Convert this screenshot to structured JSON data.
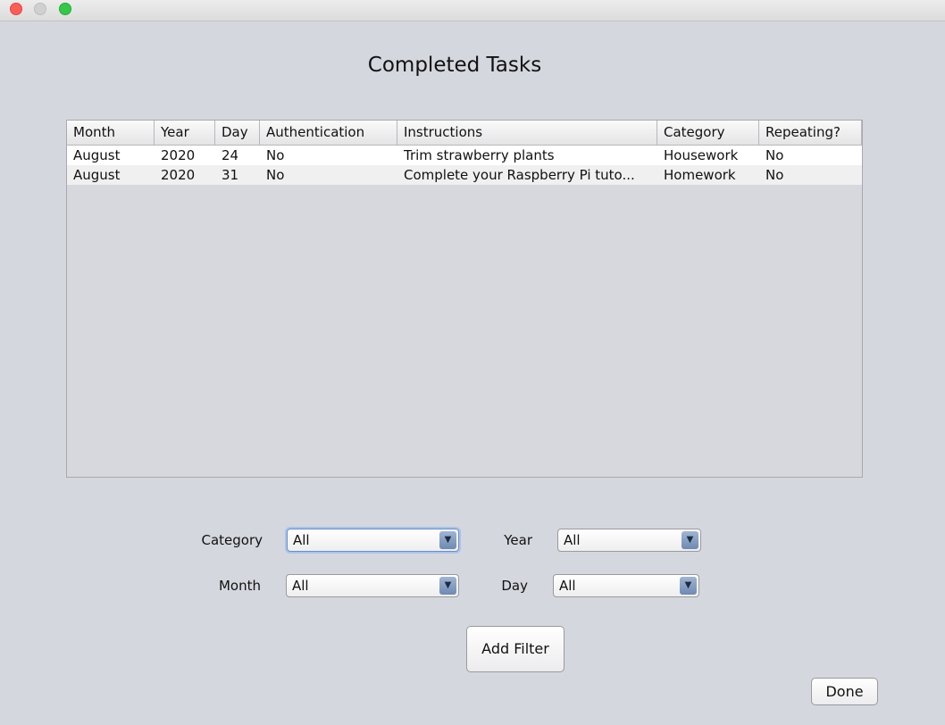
{
  "window": {
    "title": "Completed Tasks"
  },
  "table": {
    "columns": [
      "Month",
      "Year",
      "Day",
      "Authentication",
      "Instructions",
      "Category",
      "Repeating?"
    ],
    "rows": [
      [
        "August",
        "2020",
        "24",
        "No",
        "Trim strawberry plants",
        "Housework",
        "No"
      ],
      [
        "August",
        "2020",
        "31",
        "No",
        "Complete your Raspberry Pi tuto...",
        "Homework",
        "No"
      ]
    ]
  },
  "filters": {
    "category_label": "Category",
    "category_value": "All",
    "year_label": "Year",
    "year_value": "All",
    "month_label": "Month",
    "month_value": "All",
    "day_label": "Day",
    "day_value": "All"
  },
  "buttons": {
    "add_filter": "Add Filter",
    "done": "Done"
  },
  "icons": {
    "dropdown": "chevron-down-icon"
  }
}
